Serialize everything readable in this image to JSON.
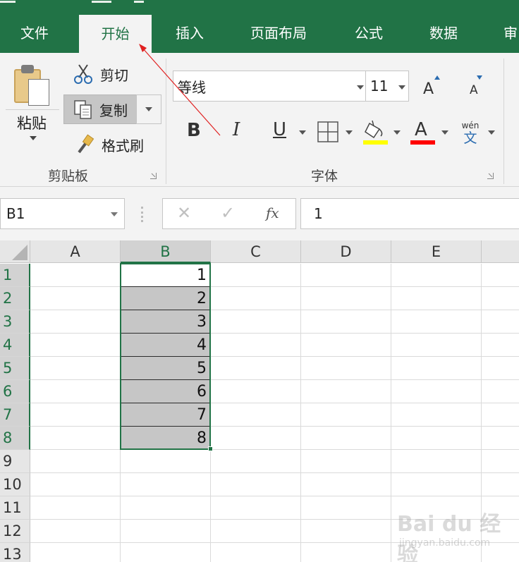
{
  "tabs": [
    {
      "label": "文件",
      "active": false
    },
    {
      "label": "开始",
      "active": true
    },
    {
      "label": "插入",
      "active": false
    },
    {
      "label": "页面布局",
      "active": false
    },
    {
      "label": "公式",
      "active": false
    },
    {
      "label": "数据",
      "active": false
    },
    {
      "label": "审",
      "active": false
    }
  ],
  "ribbon": {
    "clipboard": {
      "paste": "粘贴",
      "cut": "剪切",
      "copy": "复制",
      "format_painter": "格式刷",
      "group_label": "剪贴板"
    },
    "font": {
      "name": "等线",
      "size": "11",
      "bold": "B",
      "italic": "I",
      "underline": "U",
      "font_color": "A",
      "phonetic_top": "wén",
      "phonetic_bottom": "文",
      "group_label": "字体",
      "highlight_color": "#ffff00",
      "font_color_value": "#ff0000"
    }
  },
  "formula_bar": {
    "name_box": "B1",
    "fx": "fx",
    "value": "1"
  },
  "grid": {
    "columns": [
      "A",
      "B",
      "C",
      "D",
      "E"
    ],
    "rows": [
      "1",
      "2",
      "3",
      "4",
      "5",
      "6",
      "7",
      "8",
      "9",
      "10",
      "11",
      "12",
      "13"
    ],
    "selected_column": "B",
    "b_values": [
      "1",
      "2",
      "3",
      "4",
      "5",
      "6",
      "7",
      "8"
    ]
  },
  "watermark": {
    "main": "Bai du 经验",
    "sub": "jingyan.baidu.com"
  },
  "colors": {
    "brand_green": "#217346",
    "annotation_arrow": "#e02020"
  }
}
